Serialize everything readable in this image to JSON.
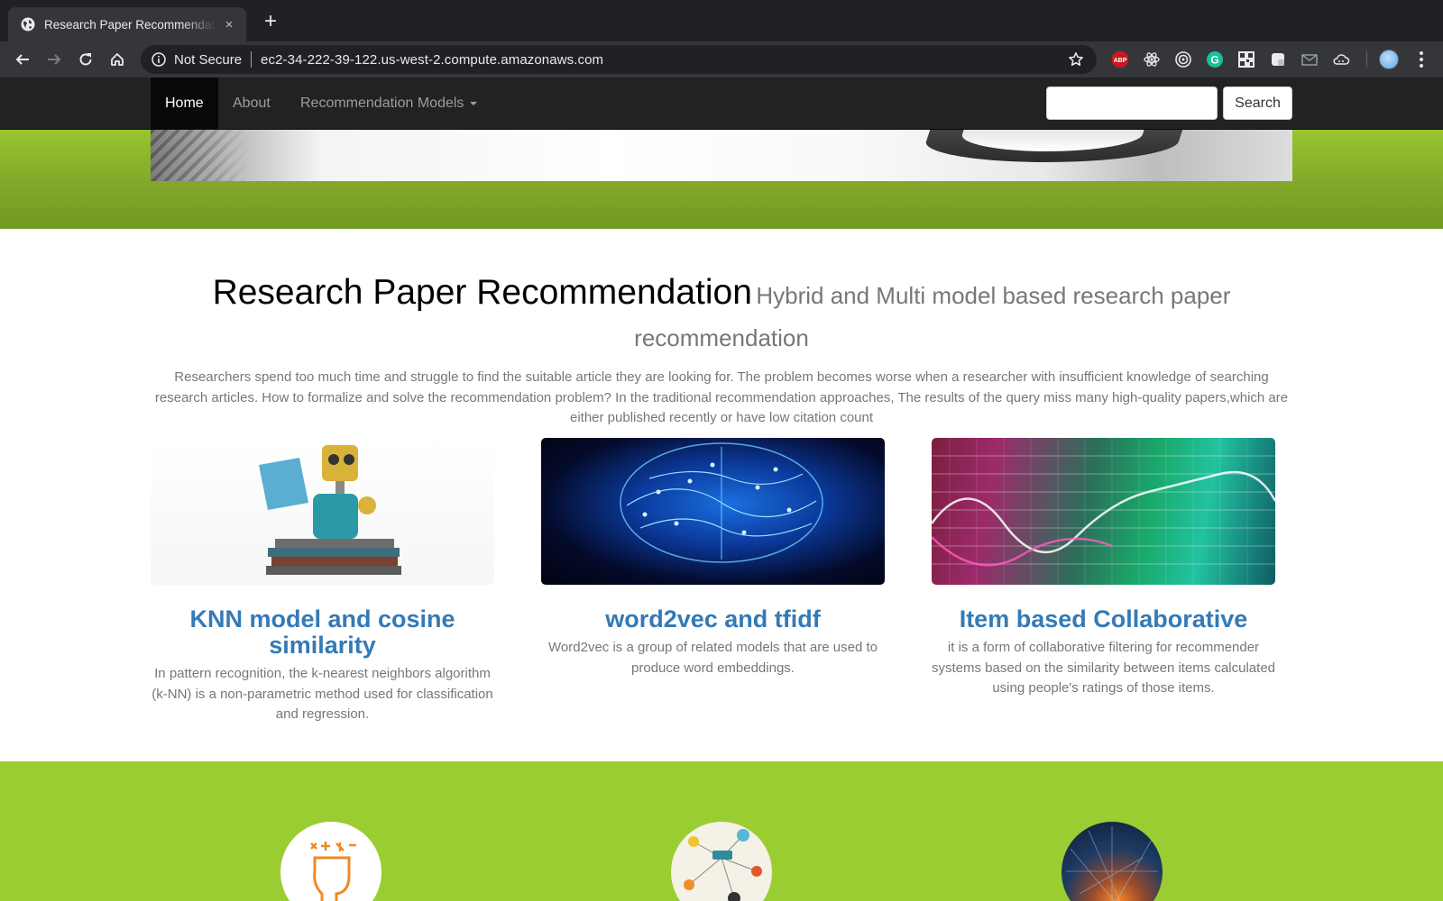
{
  "browser": {
    "tab_title": "Research Paper Recommendation",
    "tab_close": "×",
    "new_tab": "+",
    "not_secure": "Not Secure",
    "url": "ec2-34-222-39-122.us-west-2.compute.amazonaws.com",
    "extensions": [
      "adblock-plus-icon",
      "react-devtools-icon",
      "target-extension-icon",
      "grammarly-icon",
      "qr-extension-icon",
      "note-extension-icon",
      "mail-extension-icon",
      "cloud-extension-icon"
    ],
    "abp_label": "ABP",
    "grammarly_label": "G"
  },
  "navbar": {
    "items": [
      {
        "label": "Home",
        "active": true
      },
      {
        "label": "About",
        "active": false
      },
      {
        "label": "Recommendation Models",
        "active": false,
        "dropdown": true
      }
    ],
    "search_placeholder": "",
    "search_button": "Search"
  },
  "main": {
    "title": "Research Paper Recommendation",
    "subtitle": "Hybrid and Multi model based research paper recommendation",
    "intro": "Researchers spend too much time and struggle to find the suitable article they are looking for. The problem becomes worse when a researcher with insufficient knowledge of searching research articles. How to formalize and solve the recommendation problem? In the traditional recommendation approaches, The results of the query miss many high-quality papers,which are either published recently or have low citation count"
  },
  "cards": [
    {
      "title": "KNN model and cosine similarity",
      "text": "In pattern recognition, the k-nearest neighbors algorithm (k-NN) is a non-parametric method used for classification and regression."
    },
    {
      "title": "word2vec and tfidf",
      "text": "Word2vec is a group of related models that are used to produce word embeddings."
    },
    {
      "title": "Item based Collaborative",
      "text": "it is a form of collaborative filtering for recommender systems based on the similarity between items calculated using people's ratings of those items."
    }
  ],
  "colors": {
    "browser_dark": "#202124",
    "browser_toolbar": "#35363a",
    "navbar": "#222222",
    "hero_green": "#80a529",
    "band_green": "#9acd32",
    "link_blue": "#337ab7",
    "muted_text": "#777777"
  }
}
